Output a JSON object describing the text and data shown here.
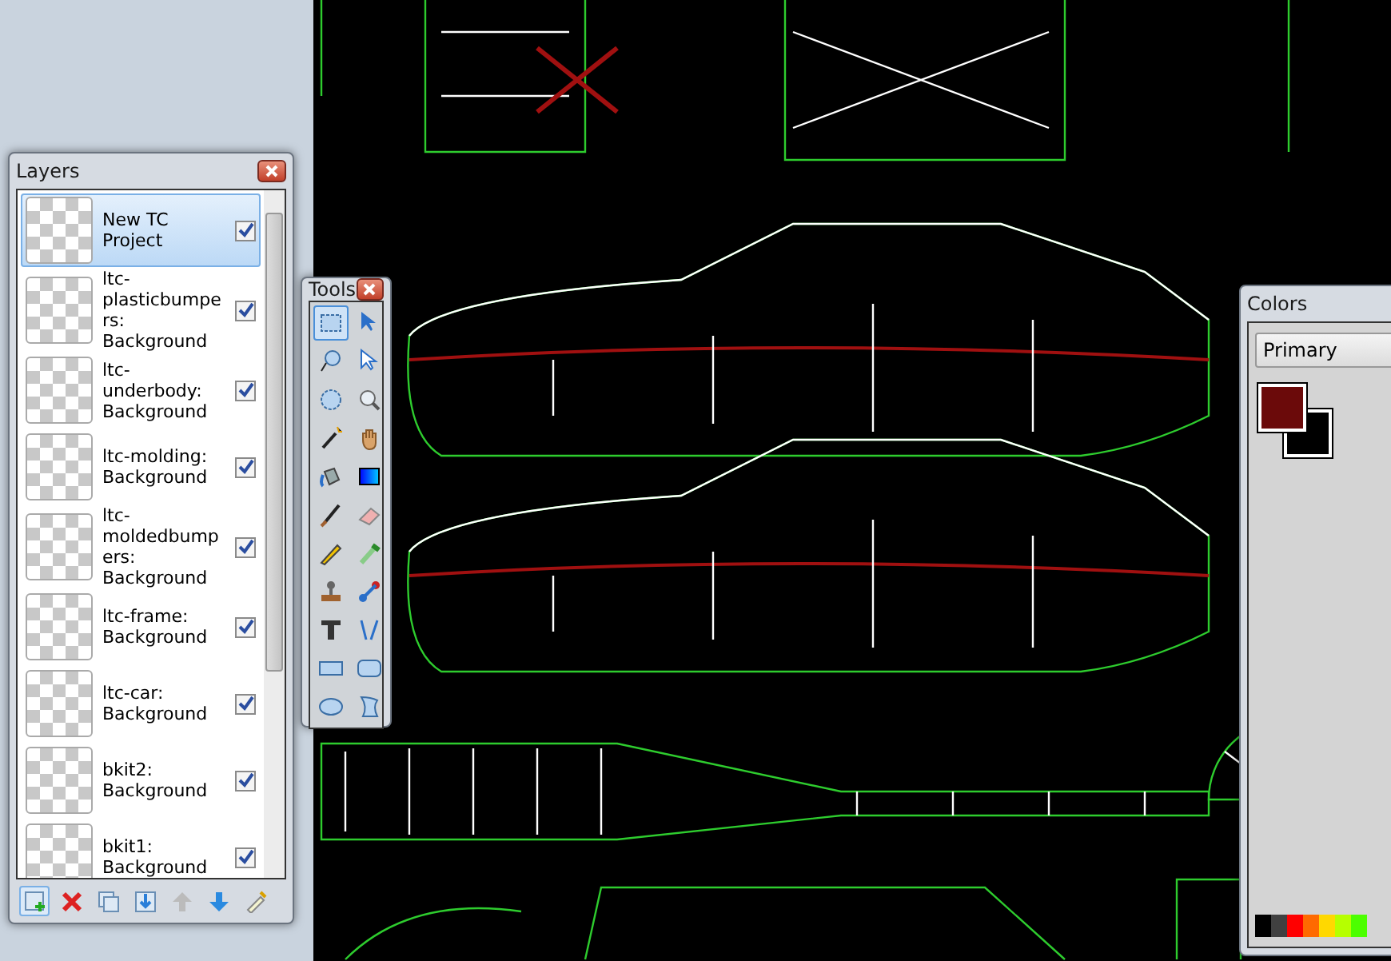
{
  "layers_window": {
    "title": "Layers",
    "layers": [
      {
        "name": "New TC Project",
        "visible": true,
        "selected": true
      },
      {
        "name": "ltc-plasticbumpers: Background",
        "visible": true,
        "selected": false
      },
      {
        "name": "ltc-underbody: Background",
        "visible": true,
        "selected": false
      },
      {
        "name": "ltc-molding: Background",
        "visible": true,
        "selected": false
      },
      {
        "name": "ltc-moldedbumpers: Background",
        "visible": true,
        "selected": false
      },
      {
        "name": "ltc-frame: Background",
        "visible": true,
        "selected": false
      },
      {
        "name": "ltc-car: Background",
        "visible": true,
        "selected": false
      },
      {
        "name": "bkit2: Background",
        "visible": true,
        "selected": false
      },
      {
        "name": "bkit1: Background",
        "visible": true,
        "selected": false
      }
    ]
  },
  "tools_window": {
    "title": "Tools",
    "tools": [
      {
        "kind": "rect-select",
        "selected": true
      },
      {
        "kind": "move",
        "selected": false
      },
      {
        "kind": "lasso",
        "selected": false
      },
      {
        "kind": "move-selection",
        "selected": false
      },
      {
        "kind": "ellipse-select",
        "selected": false
      },
      {
        "kind": "zoom",
        "selected": false
      },
      {
        "kind": "wand",
        "selected": false
      },
      {
        "kind": "pan",
        "selected": false
      },
      {
        "kind": "bucket",
        "selected": false
      },
      {
        "kind": "gradient",
        "selected": false
      },
      {
        "kind": "brush",
        "selected": false
      },
      {
        "kind": "eraser",
        "selected": false
      },
      {
        "kind": "pencil",
        "selected": false
      },
      {
        "kind": "picker",
        "selected": false
      },
      {
        "kind": "stamp",
        "selected": false
      },
      {
        "kind": "recolor",
        "selected": false
      },
      {
        "kind": "text",
        "selected": false
      },
      {
        "kind": "line",
        "selected": false
      },
      {
        "kind": "rectangle",
        "selected": false
      },
      {
        "kind": "rounded",
        "selected": false
      },
      {
        "kind": "ellipse",
        "selected": false
      },
      {
        "kind": "freeform",
        "selected": false
      }
    ]
  },
  "colors_window": {
    "title": "Colors",
    "mode": "Primary",
    "primary": {
      "color": "#6b0a0a"
    },
    "secondary": {
      "color": "#000000"
    },
    "palette": [
      {
        "color": "#000000"
      },
      {
        "color": "#404040"
      },
      {
        "color": "#ff0000"
      },
      {
        "color": "#ff6a00"
      },
      {
        "color": "#ffd800"
      },
      {
        "color": "#b6ff00"
      },
      {
        "color": "#4cff00"
      }
    ]
  }
}
